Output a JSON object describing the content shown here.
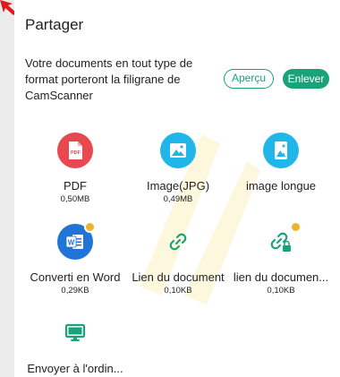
{
  "header": {
    "title": "Partager"
  },
  "notice": {
    "text": "Votre documents en tout type de format porteront la filigrane de CamScanner"
  },
  "actions": {
    "preview_label": "Aperçu",
    "remove_label": "Enlever"
  },
  "colors": {
    "accent_green": "#1aa37a",
    "pdf_red": "#e8484f",
    "image_blue": "#21b6e8",
    "word_blue": "#1f74d6",
    "link_green": "#1aa37a",
    "badge_gold": "#f0b429"
  },
  "options": [
    {
      "label": "PDF",
      "size": "0,50MB",
      "icon": "pdf-icon"
    },
    {
      "label": "Image(JPG)",
      "size": "0,49MB",
      "icon": "image-icon"
    },
    {
      "label": "image longue",
      "size": "",
      "icon": "long-image-icon"
    },
    {
      "label": "Converti en Word",
      "size": "0,29KB",
      "icon": "word-icon"
    },
    {
      "label": "Lien du document",
      "size": "0,10KB",
      "icon": "link-icon"
    },
    {
      "label": "lien du documen...",
      "size": "0,10KB",
      "icon": "secure-link-icon"
    },
    {
      "label": "Envoyer à l'ordin...",
      "size": "",
      "icon": "computer-icon"
    }
  ]
}
